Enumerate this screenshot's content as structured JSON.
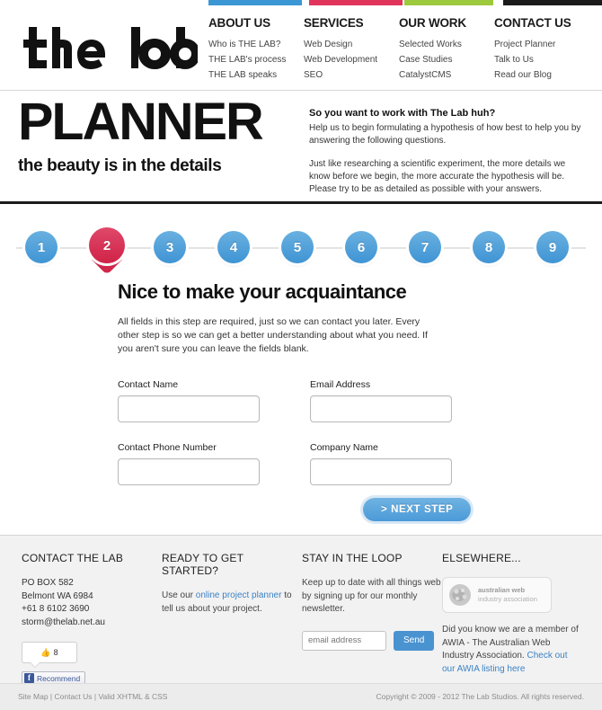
{
  "brand": {
    "logo_text": "thelab",
    "colors": {
      "blue": "#3b97d3",
      "pink": "#e0345c",
      "green": "#9dc93d",
      "black": "#1b1b1b",
      "link": "#3b82c4"
    }
  },
  "nav": {
    "columns": [
      {
        "id": "about-us",
        "title": "ABOUT US",
        "bar_color": "#3b97d3",
        "items": [
          "Who is THE LAB?",
          "THE LAB's process",
          "THE LAB speaks"
        ]
      },
      {
        "id": "services",
        "title": "SERVICES",
        "bar_color": "#e0345c",
        "items": [
          "Web Design",
          "Web Development",
          "SEO"
        ]
      },
      {
        "id": "our-work",
        "title": "OUR WORK",
        "bar_color": "#9dc93d",
        "items": [
          "Selected Works",
          "Case Studies",
          "CatalystCMS"
        ]
      },
      {
        "id": "contact-us",
        "title": "CONTACT US",
        "bar_color": "#1b1b1b",
        "items": [
          "Project Planner",
          "Talk to Us",
          "Read our Blog"
        ]
      }
    ]
  },
  "hero": {
    "title": "PLANNER",
    "tagline": "the beauty is in the details",
    "intro_heading": "So you want to work with The Lab huh?",
    "intro_p1": "Help us to begin formulating a hypothesis of how best to help you by answering the following questions.",
    "intro_p2": "Just like researching a scientific experiment, the more details we know before we begin, the more accurate the hypothesis will be. Please try to be as detailed as possible with your answers."
  },
  "steps": {
    "active": 2,
    "items": [
      "1",
      "2",
      "3",
      "4",
      "5",
      "6",
      "7",
      "8",
      "9"
    ]
  },
  "form": {
    "heading": "Nice to make your acquaintance",
    "description": "All fields in this step are required, just so we can contact you later. Every other step is so we can get a better understanding about what you need. If you aren't sure you can leave the fields blank.",
    "fields": [
      {
        "id": "contact-name",
        "label": "Contact Name",
        "value": "",
        "placeholder": ""
      },
      {
        "id": "email-address",
        "label": "Email Address",
        "value": "",
        "placeholder": ""
      },
      {
        "id": "contact-phone",
        "label": "Contact Phone Number",
        "value": "",
        "placeholder": ""
      },
      {
        "id": "company-name",
        "label": "Company Name",
        "value": "",
        "placeholder": ""
      }
    ],
    "next_button": "> NEXT STEP"
  },
  "footer": {
    "contact": {
      "title": "CONTACT THE LAB",
      "po_box": "PO BOX 582",
      "suburb": "Belmont WA 6984",
      "phone": "+61 8 6102 3690",
      "email": "storm@thelab.net.au",
      "fb_like_count": "8",
      "fb_recommend_label": "Recommend",
      "fb_icon_letter": "f"
    },
    "started": {
      "title": "READY TO GET STARTED?",
      "text_before": "Use our ",
      "link": "online project planner",
      "text_after": " to tell us about your project."
    },
    "loop": {
      "title": "STAY IN THE LOOP",
      "text": "Keep up to date with all things web by signing up for our monthly newsletter.",
      "email_value": "",
      "email_placeholder": "email address",
      "send_label": "Send"
    },
    "elsewhere": {
      "title": "ELSEWHERE...",
      "badge_line1": "australian web",
      "badge_line2": "industry association",
      "text_before": "Did you know we are a member of AWIA - The Australian Web Industry Association. ",
      "link": "Check out our AWIA listing here"
    }
  },
  "bottom": {
    "links": [
      "Site Map",
      "Contact Us",
      "Valid XHTML & CSS"
    ],
    "separator": " | ",
    "copyright": "Copyright © 2009 - 2012 The Lab Studios. All rights reserved."
  }
}
